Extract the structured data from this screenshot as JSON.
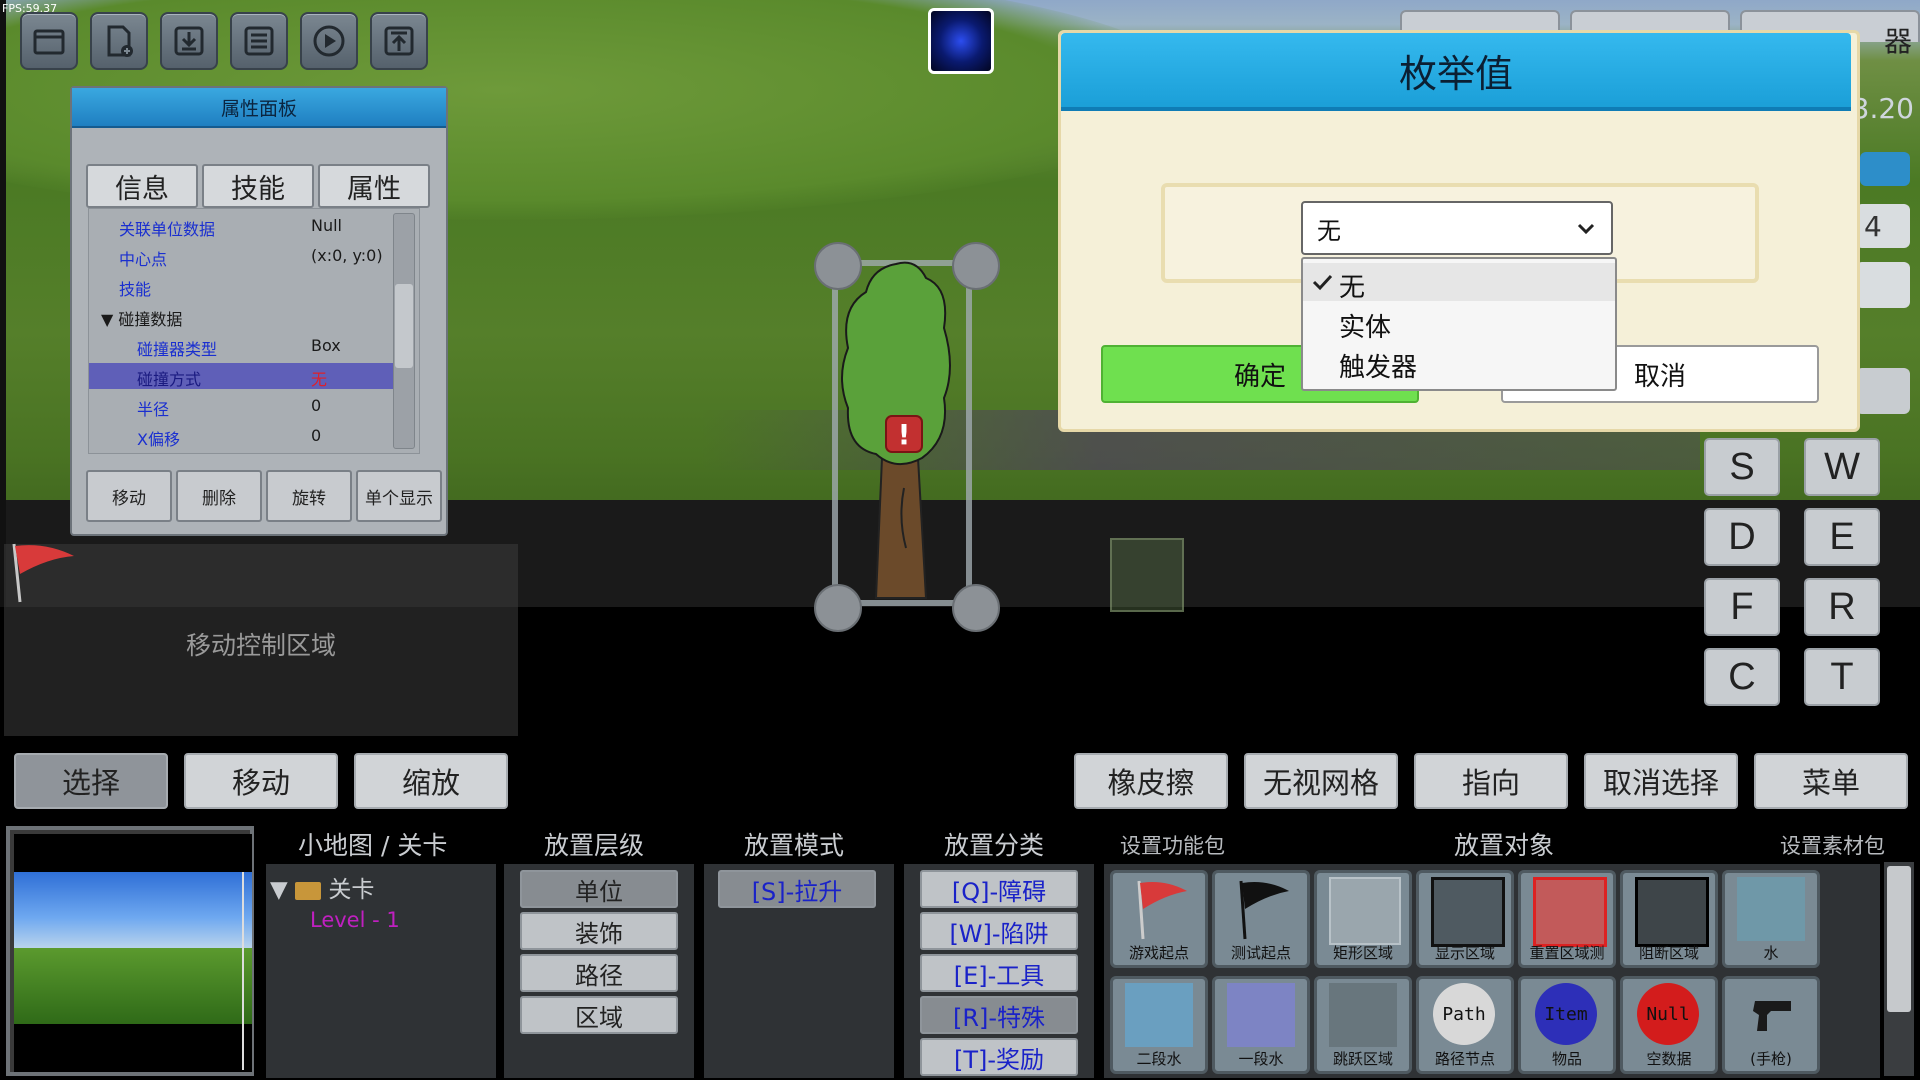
{
  "fps": "FPS:59.37",
  "toolbar": {
    "icons": [
      "folder-icon",
      "new-file-icon",
      "download-icon",
      "save-icon",
      "play-icon",
      "upload-icon"
    ]
  },
  "top_right": {
    "tab_text": "器",
    "side_number": "3.20",
    "side_digit": "4"
  },
  "property_panel": {
    "title": "属性面板",
    "tabs": [
      "信息",
      "技能",
      "属性"
    ],
    "rows": [
      {
        "key": "关联单位数据",
        "value": "Null",
        "kind": "item"
      },
      {
        "key": "中心点",
        "value": "(x:0, y:0)",
        "kind": "item"
      },
      {
        "key": "技能",
        "value": "",
        "kind": "item"
      },
      {
        "key": "▼ 碰撞数据",
        "value": "",
        "kind": "group"
      },
      {
        "key": "碰撞器类型",
        "value": "Box",
        "kind": "sub"
      },
      {
        "key": "碰撞方式",
        "value": "无",
        "kind": "sub",
        "selected": true
      },
      {
        "key": "半径",
        "value": "0",
        "kind": "sub"
      },
      {
        "key": "X偏移",
        "value": "0",
        "kind": "sub"
      }
    ],
    "buttons": [
      "移动",
      "删除",
      "旋转",
      "单个显示"
    ]
  },
  "move_area_label": "移动控制区域",
  "keys": [
    "S",
    "W",
    "D",
    "E",
    "F",
    "R",
    "C",
    "T"
  ],
  "dialog": {
    "title": "枚举值",
    "selected_value": "无",
    "options": [
      "无",
      "实体",
      "触发器"
    ],
    "selected_index": 0,
    "confirm_label": "确定",
    "cancel_label": "取消"
  },
  "bottom_toolbar": {
    "left": [
      "选择",
      "移动",
      "缩放"
    ],
    "right": [
      "橡皮擦",
      "无视网格",
      "指向",
      "取消选择",
      "菜单"
    ],
    "active": "选择"
  },
  "sections": {
    "minimap_title": "小地图 / 关卡",
    "layer_title": "放置层级",
    "mode_title": "放置模式",
    "category_title": "放置分类",
    "func_pack_title": "设置功能包",
    "objects_title": "放置对象",
    "material_title": "设置素材包"
  },
  "level_tree": {
    "folder": "关卡",
    "level": "Level - 1"
  },
  "layers": [
    "单位",
    "装饰",
    "路径",
    "区域"
  ],
  "modes": [
    "[S]-拉升"
  ],
  "categories": [
    "[Q]-障碍",
    "[W]-陷阱",
    "[E]-工具",
    "[R]-特殊",
    "[T]-奖励"
  ],
  "objects_row1": [
    "游戏起点",
    "测试起点",
    "矩形区域",
    "显示区域",
    "重置区域测",
    "阻断区域",
    "水"
  ],
  "objects_row2": [
    "二段水",
    "一段水",
    "跳跃区域",
    "路径节点",
    "物品",
    "空数据",
    "(手枪)"
  ],
  "object_icon_text": {
    "path": "Path",
    "item": "Item",
    "null": "Null"
  },
  "colors": {
    "accent": "#1b9fd8",
    "confirm": "#6fe04f",
    "selected_row": "#5f5fb8"
  }
}
